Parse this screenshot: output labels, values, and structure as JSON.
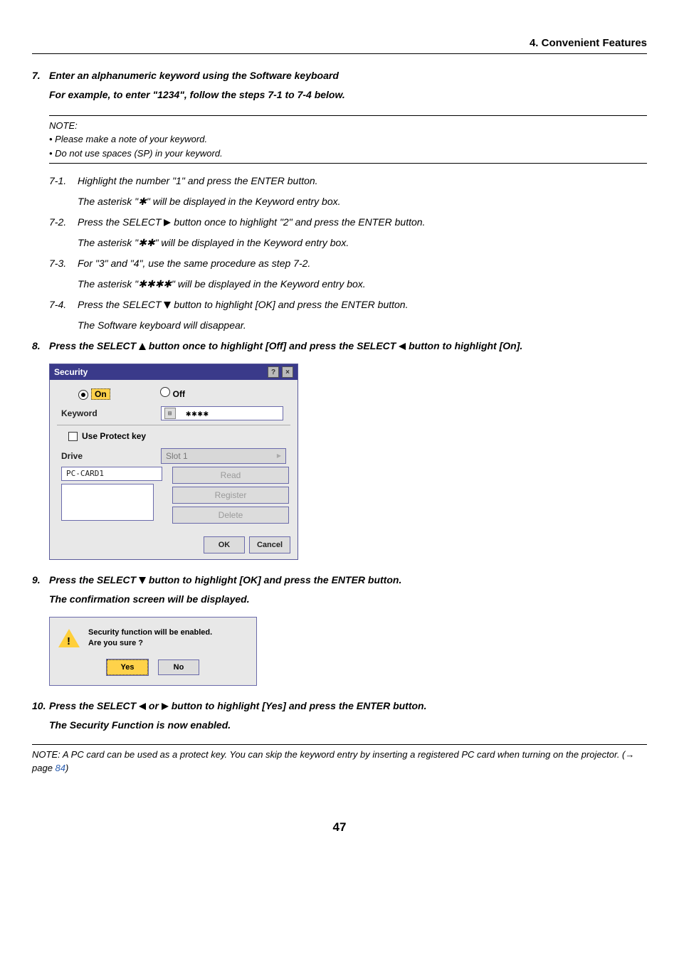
{
  "header": {
    "section": "4. Convenient Features"
  },
  "step7": {
    "num": "7.",
    "line1": "Enter an alphanumeric keyword using the Software keyboard",
    "line2": "For example, to enter \"1234\", follow the steps 7-1 to 7-4 below."
  },
  "note1": {
    "title": "NOTE:",
    "b1": "• Please make a note of your keyword.",
    "b2": "• Do not use spaces (SP) in your keyword."
  },
  "s71": {
    "num": "7-1.",
    "l1": "Highlight the number \"1\" and press the ENTER button.",
    "l2": "The asterisk \"✱\" will be displayed in the Keyword entry box."
  },
  "s72": {
    "num": "7-2.",
    "l1a": "Press the SELECT ",
    "l1b": " button once to highlight \"2\" and press the ENTER button.",
    "l2": "The asterisk \"✱✱\" will be displayed in the Keyword entry box."
  },
  "s73": {
    "num": "7-3.",
    "l1": "For \"3\" and \"4\", use the same procedure as step 7-2.",
    "l2": "The asterisk \"✱✱✱✱\" will be displayed in the Keyword entry box."
  },
  "s74": {
    "num": "7-4.",
    "l1a": "Press the SELECT ",
    "l1b": " button to highlight [OK] and press the ENTER button.",
    "l2": "The Software keyboard will disappear."
  },
  "step8": {
    "num": "8.",
    "p1": "Press the SELECT ",
    "p2": " button once to highlight [Off] and press the SELECT ",
    "p3": " button to highlight [On]."
  },
  "dialog": {
    "title": "Security",
    "on": "On",
    "off": "Off",
    "keyword_lbl": "Keyword",
    "keyword_val": "✱✱✱✱",
    "use_protect": "Use Protect key",
    "drive_lbl": "Drive",
    "slot": "Slot 1",
    "card": "PC-CARD1",
    "btn_read": "Read",
    "btn_register": "Register",
    "btn_delete": "Delete",
    "ok": "OK",
    "cancel": "Cancel"
  },
  "step9": {
    "num": "9.",
    "l1a": "Press the SELECT ",
    "l1b": " button to highlight [OK] and press the ENTER button.",
    "l2": "The confirmation screen will be displayed."
  },
  "confirm": {
    "l1": "Security function will be enabled.",
    "l2": "Are you sure ?",
    "yes": "Yes",
    "no": "No"
  },
  "step10": {
    "num": "10.",
    "l1a": "Press the SELECT ",
    "l1b": " or ",
    "l1c": " button to highlight [Yes] and press the ENTER button.",
    "l2": "The Security Function is now enabled."
  },
  "note2": {
    "t1": "NOTE: A PC card can be used as a protect key. You can skip the keyword entry by inserting a registered PC card when turning on the projector. (→ page ",
    "pg": "84",
    "t2": ")"
  },
  "pagenum": "47"
}
